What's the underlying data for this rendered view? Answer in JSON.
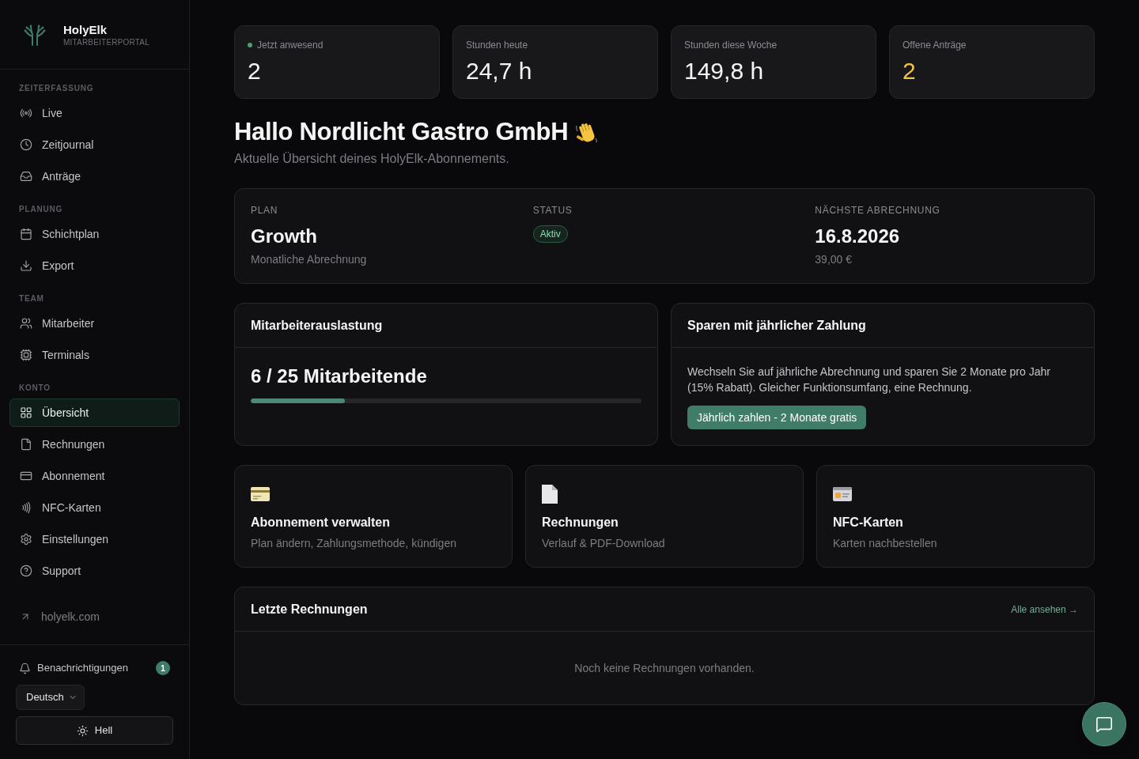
{
  "sidebar": {
    "brand": {
      "name": "HolyElk",
      "tagline": "MITARBEITERPORTAL"
    },
    "sections": [
      {
        "label": "ZEITERFASSUNG",
        "items": [
          {
            "label": "Live",
            "selected": false
          },
          {
            "label": "Zeitjournal",
            "selected": false
          },
          {
            "label": "Anträge",
            "selected": false
          }
        ]
      },
      {
        "label": "PLANUNG",
        "items": [
          {
            "label": "Schichtplan",
            "selected": false
          },
          {
            "label": "Export",
            "selected": false
          }
        ]
      },
      {
        "label": "TEAM",
        "items": [
          {
            "label": "Mitarbeiter",
            "selected": false
          },
          {
            "label": "Terminals",
            "selected": false
          }
        ]
      },
      {
        "label": "KONTO",
        "items": [
          {
            "label": "Übersicht",
            "selected": true
          },
          {
            "label": "Rechnungen",
            "selected": false
          },
          {
            "label": "Abonnement",
            "selected": false
          },
          {
            "label": "NFC-Karten",
            "selected": false
          },
          {
            "label": "Einstellungen",
            "selected": false
          },
          {
            "label": "Support",
            "selected": false
          }
        ]
      }
    ],
    "external_link": {
      "label": "holyelk.com"
    },
    "notifications": {
      "label": "Benachrichtigungen",
      "count": "1"
    },
    "language_select": {
      "value": "Deutsch"
    },
    "theme_button": {
      "label": "Hell"
    }
  },
  "stats": [
    {
      "label": "Jetzt anwesend",
      "value": "2",
      "live": true,
      "highlighted": false
    },
    {
      "label": "Stunden heute",
      "value": "24,7 h",
      "live": false,
      "highlighted": false
    },
    {
      "label": "Stunden diese Woche",
      "value": "149,8 h",
      "live": false,
      "highlighted": false
    },
    {
      "label": "Offene Anträge",
      "value": "2",
      "live": false,
      "highlighted": true
    }
  ],
  "greeting": {
    "title": "Hallo Nordlicht Gastro GmbH",
    "subtitle": "Aktuelle Übersicht deines HolyElk-Abonnements."
  },
  "plan": {
    "plan_label": "PLAN",
    "plan_name": "Growth",
    "billing_cycle": "Monatliche Abrechnung",
    "status_label": "STATUS",
    "status": "Aktiv",
    "next_billing_label": "NÄCHSTE ABRECHNUNG",
    "next_billing_date": "16.8.2026",
    "amount": "39,00 €"
  },
  "usage": {
    "title": "Mitarbeiterauslastung",
    "value": "6 / 25 Mitarbeitende",
    "level": 0.24
  },
  "annual_offer": {
    "title": "Sparen mit jährlicher Zahlung",
    "text": "Wechseln Sie auf jährliche Abrechnung und sparen Sie 2 Monate pro Jahr (15% Rabatt). Gleicher Funktionsumfang, eine Rechnung.",
    "button": "Jährlich zahlen - 2 Monate gratis"
  },
  "quick_links": [
    {
      "title": "Abonnement verwalten",
      "description": "Plan ändern, Zahlungsmethode, kündigen"
    },
    {
      "title": "Rechnungen",
      "description": "Verlauf & PDF-Download"
    },
    {
      "title": "NFC-Karten",
      "description": "Karten nachbestellen"
    }
  ],
  "recent_invoices": {
    "title": "Letzte Rechnungen",
    "link": "Alle ansehen →",
    "empty_text": "Noch keine Rechnungen vorhanden."
  }
}
